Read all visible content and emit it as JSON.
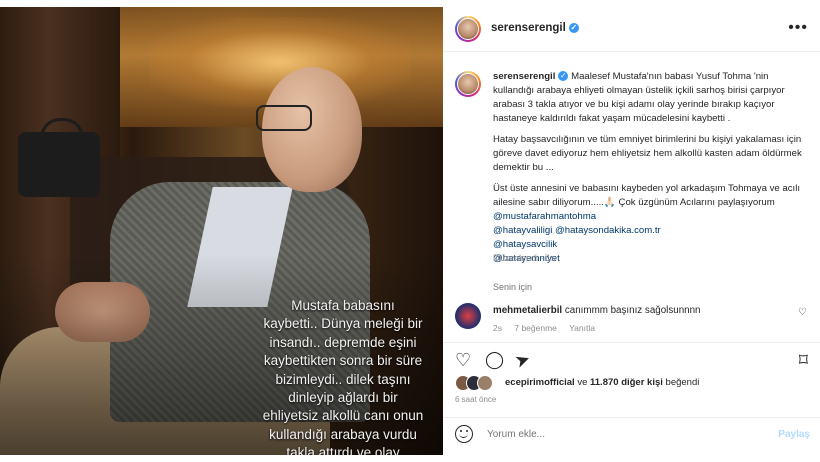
{
  "photo": {
    "overlay_lines": "Mustafa babasını\nkaybetti.. Dünya meleği bir\ninsandı.. depremde eşini\nkaybettikten sonra bir süre\nbizimleydi.. dilek taşını\ndinleyip ağlardı bir\nehliyetsiz alkollü canı onun\nkullandığı arabaya vurdu\ntakla attırdı ve olay\nyerinden kaçtı.. Mustafa'ya"
  },
  "header": {
    "username": "serenserengil",
    "verified_icon": "✓",
    "more_icon": "•••"
  },
  "caption": {
    "username": "serenserengil",
    "para1": "Maalesef Mustafa'nın babası Yusuf Tohma 'nin kullandığı arabaya ehliyeti olmayan üstelik içkili sarhoş birisi çarpıyor arabası 3 takla atıyor ve bu kişi adamı olay yerinde bırakıp kaçıyor hastaneye kaldırıldı fakat yaşam mücadelesini kaybetti .",
    "para2": "Hatay başsavcılığının ve tüm emniyet birimlerini bu kişiyi yakalaması için göreve davet ediyoruz hem ehliyetsiz hem alkollü kasten adam öldürmek demektir bu ...",
    "para3": "Üst üste annesini ve babasını kaybeden yol arkadaşım Tohmaya ve acılı ailesine sabır diliyorum.....🙏🏻 Çok üzgünüm Acılarını paylaşıyorum",
    "tag_inline": "@mustafarahmantohma",
    "tags_line1a": "@hatayvaliligi",
    "tags_line1b": "@hataysondakika.com.tr",
    "tag_savcilik": "@hataysavcilik",
    "tag_emniyet": "@hatayemniyet",
    "edited": "Düzenlendi · 1s",
    "translate": "Senin için"
  },
  "comment": {
    "username": "mehmetalierbil",
    "text": "canımmm başınız sağolsunnnn",
    "time": "2s",
    "likes": "7 beğenme",
    "reply": "Yanıtla"
  },
  "actions": {
    "like_icon": "♡",
    "comment_icon": "◯",
    "share_icon": "➤",
    "save_icon": "⌑"
  },
  "likes": {
    "first_user": "ecepirimofficial",
    "middle": " ve ",
    "others": "11.870 diğer kişi",
    "suffix": " beğendi"
  },
  "time_ago": "6 saat önce",
  "add_comment": {
    "placeholder": "Yorum ekle...",
    "post_label": "Paylaş"
  }
}
